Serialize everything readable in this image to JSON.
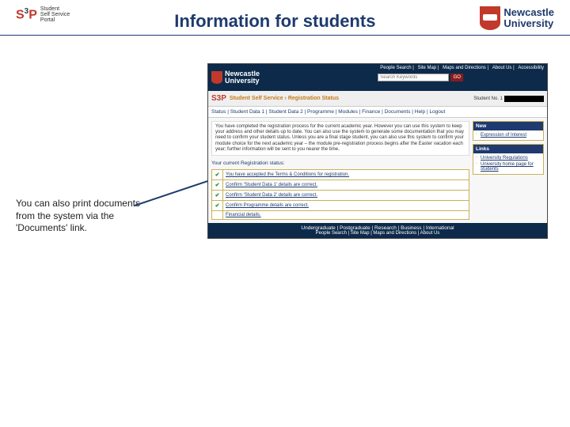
{
  "slide": {
    "title": "Information for students",
    "caption": "You can also print documents from the system via the 'Documents' link.",
    "s3p_label": "Student\nSelf Service\nPortal",
    "uni_name_line1": "Newcastle",
    "uni_name_line2": "University"
  },
  "screenshot": {
    "topbar": {
      "links": [
        "People Search",
        "Site Map",
        "Maps and Directions",
        "About Us",
        "Accessibility"
      ],
      "search_placeholder": "Search Keywords",
      "go": "GO",
      "uni1": "Newcastle",
      "uni2": "University"
    },
    "bar2": {
      "s3p": "S3P",
      "crumb": "Student Self Service › Registration Status",
      "student_label": "Student No. 1"
    },
    "nav": "Status | Student Data 1 | Student Data 2 | Programme | Modules | Finance | Documents | Help | Logout",
    "paragraph": "You have completed the registration process for the current academic year. However you can use this system to keep your address and other details up to date. You can also use the system to generate some documentation that you may need to confirm your student status. Unless you are a final stage student, you can also use this system to confirm your module choice for the next academic year – the module pre-registration process begins after the Easter vacation each year; further information will be sent to you nearer the time.",
    "current_status_label": "Your current Registration status:",
    "rows": [
      "You have accepted the Terms & Conditions for registration.",
      "Confirm 'Student Data 1' details are correct.",
      "Confirm 'Student Data 2' details are correct.",
      "Confirm Programme details are correct.",
      "Financial details."
    ],
    "side_new": {
      "title": "New",
      "items": [
        "Expression of Interest"
      ]
    },
    "side_links": {
      "title": "Links",
      "items": [
        "University Regulations",
        "University home page for students"
      ]
    },
    "footer": {
      "row1": "Undergraduate | Postgraduate | Research | Business | International",
      "row2": "People Search | Site Map | Maps and Directions | About Us"
    }
  }
}
